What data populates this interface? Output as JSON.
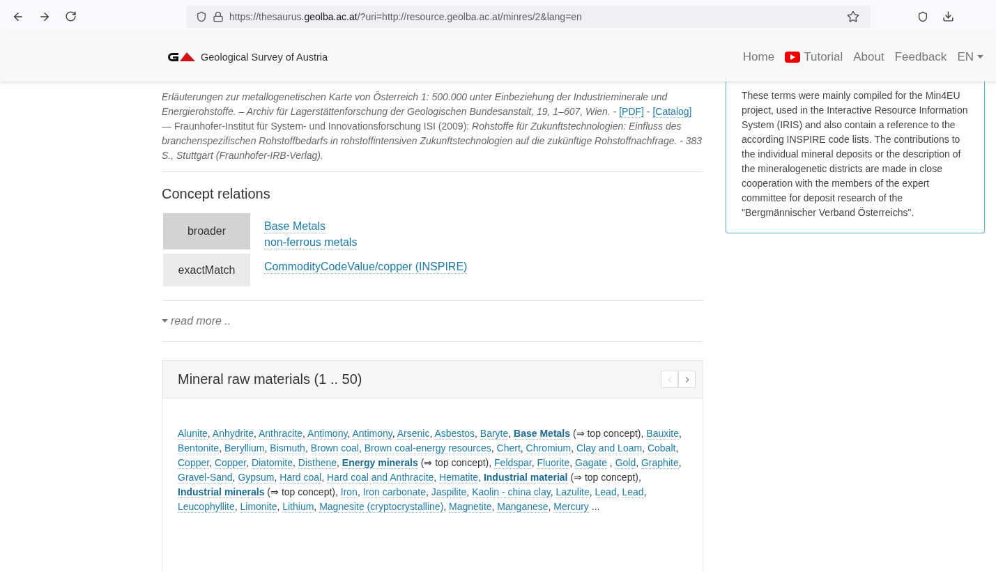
{
  "browser": {
    "url": "https://thesaurus.**geolba.ac.at**/?uri=http://resource.geolba.ac.at/minres/2&lang=en"
  },
  "header": {
    "site_title": "Geological Survey of Austria",
    "nav": [
      {
        "label": "Home",
        "kind": "link"
      },
      {
        "label": "Tutorial",
        "kind": "video"
      },
      {
        "label": "About",
        "kind": "link"
      },
      {
        "label": "Feedback",
        "kind": "link"
      },
      {
        "label": "EN",
        "kind": "dropdown"
      }
    ]
  },
  "references": [
    {
      "text": "Erläuterungen zur metallogenetischen Karte von Österreich 1: 500.000 unter Einbeziehung der Industrieminerale und Energierohstoffe. – Archiv für Lagerstättenforschung der Geologischen Bundesanstalt, 19, 1–607, Wien.",
      "links": [
        {
          "before": " - ",
          "label": "[PDF]"
        },
        {
          "before": " - ",
          "label": "[Catalog]"
        }
      ]
    },
    {
      "text": "— Fraunhofer-Institut für System- und Innovationsforschung ISI (2009): *Rohstoffe für Zukunftstechnologien: Einfluss des branchenspezifischen Rohstoffbedarfs in rohstoffintensiven Zukunftstechnologien auf die zukünftige Rohstoffnachfrage. - 383 S., Stuttgart (Fraunhofer-IRB-Verlag).*"
    }
  ],
  "concept_relations": {
    "title": "Concept relations",
    "rows": [
      {
        "label": "broader",
        "links": [
          "Base Metals",
          "non-ferrous metals"
        ]
      },
      {
        "label": "exactMatch",
        "links": [
          "CommodityCodeValue/copper (INSPIRE)"
        ]
      }
    ]
  },
  "read_more": {
    "label": "read more ..",
    "expanded": false
  },
  "mineral_card": {
    "title": "Mineral raw materials (1 .. 50)",
    "pager": [
      {
        "kind": "previous",
        "disabled": true
      },
      {
        "kind": "next",
        "disabled": false
      }
    ],
    "items": [
      {
        "label": "Alunite",
        "kind": "concept",
        "tail": ", "
      },
      {
        "label": "Anhydrite",
        "kind": "concept",
        "tail": ", "
      },
      {
        "label": "Anthracite",
        "kind": "concept",
        "tail": ", "
      },
      {
        "label": "Antimony",
        "kind": "concept",
        "tail": ", "
      },
      {
        "label": "Antimony",
        "kind": "concept",
        "tail": ", "
      },
      {
        "label": "Arsenic",
        "kind": "concept",
        "tail": ", "
      },
      {
        "label": "Asbestos",
        "kind": "concept",
        "tail": ", "
      },
      {
        "label": "Baryte",
        "kind": "concept",
        "tail": ", "
      },
      {
        "label": "Base Metals",
        "kind": "top",
        "tail": " (⇒ top concept), "
      },
      {
        "label": "Bauxite",
        "kind": "concept",
        "tail": ", "
      },
      {
        "label": "Bentonite",
        "kind": "concept",
        "tail": ", "
      },
      {
        "label": "Beryllium",
        "kind": "concept",
        "tail": ", "
      },
      {
        "label": "Bismuth",
        "kind": "concept",
        "tail": ", "
      },
      {
        "label": "Brown coal",
        "kind": "concept",
        "tail": ", "
      },
      {
        "label": "Brown coal-energy resources",
        "kind": "concept",
        "tail": ", "
      },
      {
        "label": "Chert",
        "kind": "concept",
        "tail": ", "
      },
      {
        "label": "Chromium",
        "kind": "concept",
        "tail": ", "
      },
      {
        "label": "Clay and Loam",
        "kind": "concept",
        "tail": ", "
      },
      {
        "label": "Cobalt",
        "kind": "concept",
        "tail": ", "
      },
      {
        "label": "Copper",
        "kind": "concept",
        "tail": ", "
      },
      {
        "label": "Copper",
        "kind": "concept",
        "tail": ", "
      },
      {
        "label": "Diatomite",
        "kind": "concept",
        "tail": ", "
      },
      {
        "label": "Disthene",
        "kind": "concept",
        "tail": ", "
      },
      {
        "label": "Energy minerals",
        "kind": "top",
        "tail": " (⇒ top concept), "
      },
      {
        "label": "Feldspar",
        "kind": "concept",
        "tail": ", "
      },
      {
        "label": "Fluorite",
        "kind": "concept",
        "tail": ", "
      },
      {
        "label": "Gagate",
        "kind": "concept",
        "tail": " , "
      },
      {
        "label": "Gold",
        "kind": "concept",
        "tail": ", "
      },
      {
        "label": "Graphite",
        "kind": "concept",
        "tail": ", "
      },
      {
        "label": "Gravel-Sand",
        "kind": "concept",
        "tail": ", "
      },
      {
        "label": "Gypsum",
        "kind": "concept",
        "tail": ", "
      },
      {
        "label": "Hard coal",
        "kind": "concept",
        "tail": ", "
      },
      {
        "label": "Hard coal and Anthracite",
        "kind": "concept",
        "tail": ", "
      },
      {
        "label": "Hematite",
        "kind": "concept",
        "tail": ", "
      },
      {
        "label": "Industrial material",
        "kind": "top",
        "tail": " (⇒ top concept), "
      },
      {
        "label": "Industrial minerals",
        "kind": "top",
        "tail": " (⇒ top concept), "
      },
      {
        "label": "Iron",
        "kind": "concept",
        "tail": ", "
      },
      {
        "label": "Iron carbonate",
        "kind": "concept",
        "tail": ", "
      },
      {
        "label": "Jaspilite",
        "kind": "concept",
        "tail": ", "
      },
      {
        "label": "Kaolin - china clay",
        "kind": "concept",
        "tail": ", "
      },
      {
        "label": "Lazulite",
        "kind": "concept",
        "tail": ", "
      },
      {
        "label": "Lead",
        "kind": "concept",
        "tail": ", "
      },
      {
        "label": "Lead",
        "kind": "concept",
        "tail": ", "
      },
      {
        "label": "Leucophyllite",
        "kind": "concept",
        "tail": ", "
      },
      {
        "label": "Limonite",
        "kind": "concept",
        "tail": ", "
      },
      {
        "label": "Lithium",
        "kind": "concept",
        "tail": ", "
      },
      {
        "label": "Magnesite (cryptocrystalline)",
        "kind": "concept",
        "tail": ", "
      },
      {
        "label": "Magnetite",
        "kind": "concept",
        "tail": ", "
      },
      {
        "label": "Manganese",
        "kind": "concept",
        "tail": ", "
      },
      {
        "label": "Mercury",
        "kind": "concept",
        "tail": " ..."
      }
    ]
  },
  "sidebar": {
    "text": "These terms were mainly compiled for the Min4EU project, used in the Interactive Resource Information System (IRIS) and also contain a reference to the according INSPIRE code lists. The contributions to the individual mineral deposits or the description of the mineralogenetic districts are made in close cooperation with the members of the expert committee for deposit research of the \"Bergmännischer Verband Österreichs\"."
  }
}
